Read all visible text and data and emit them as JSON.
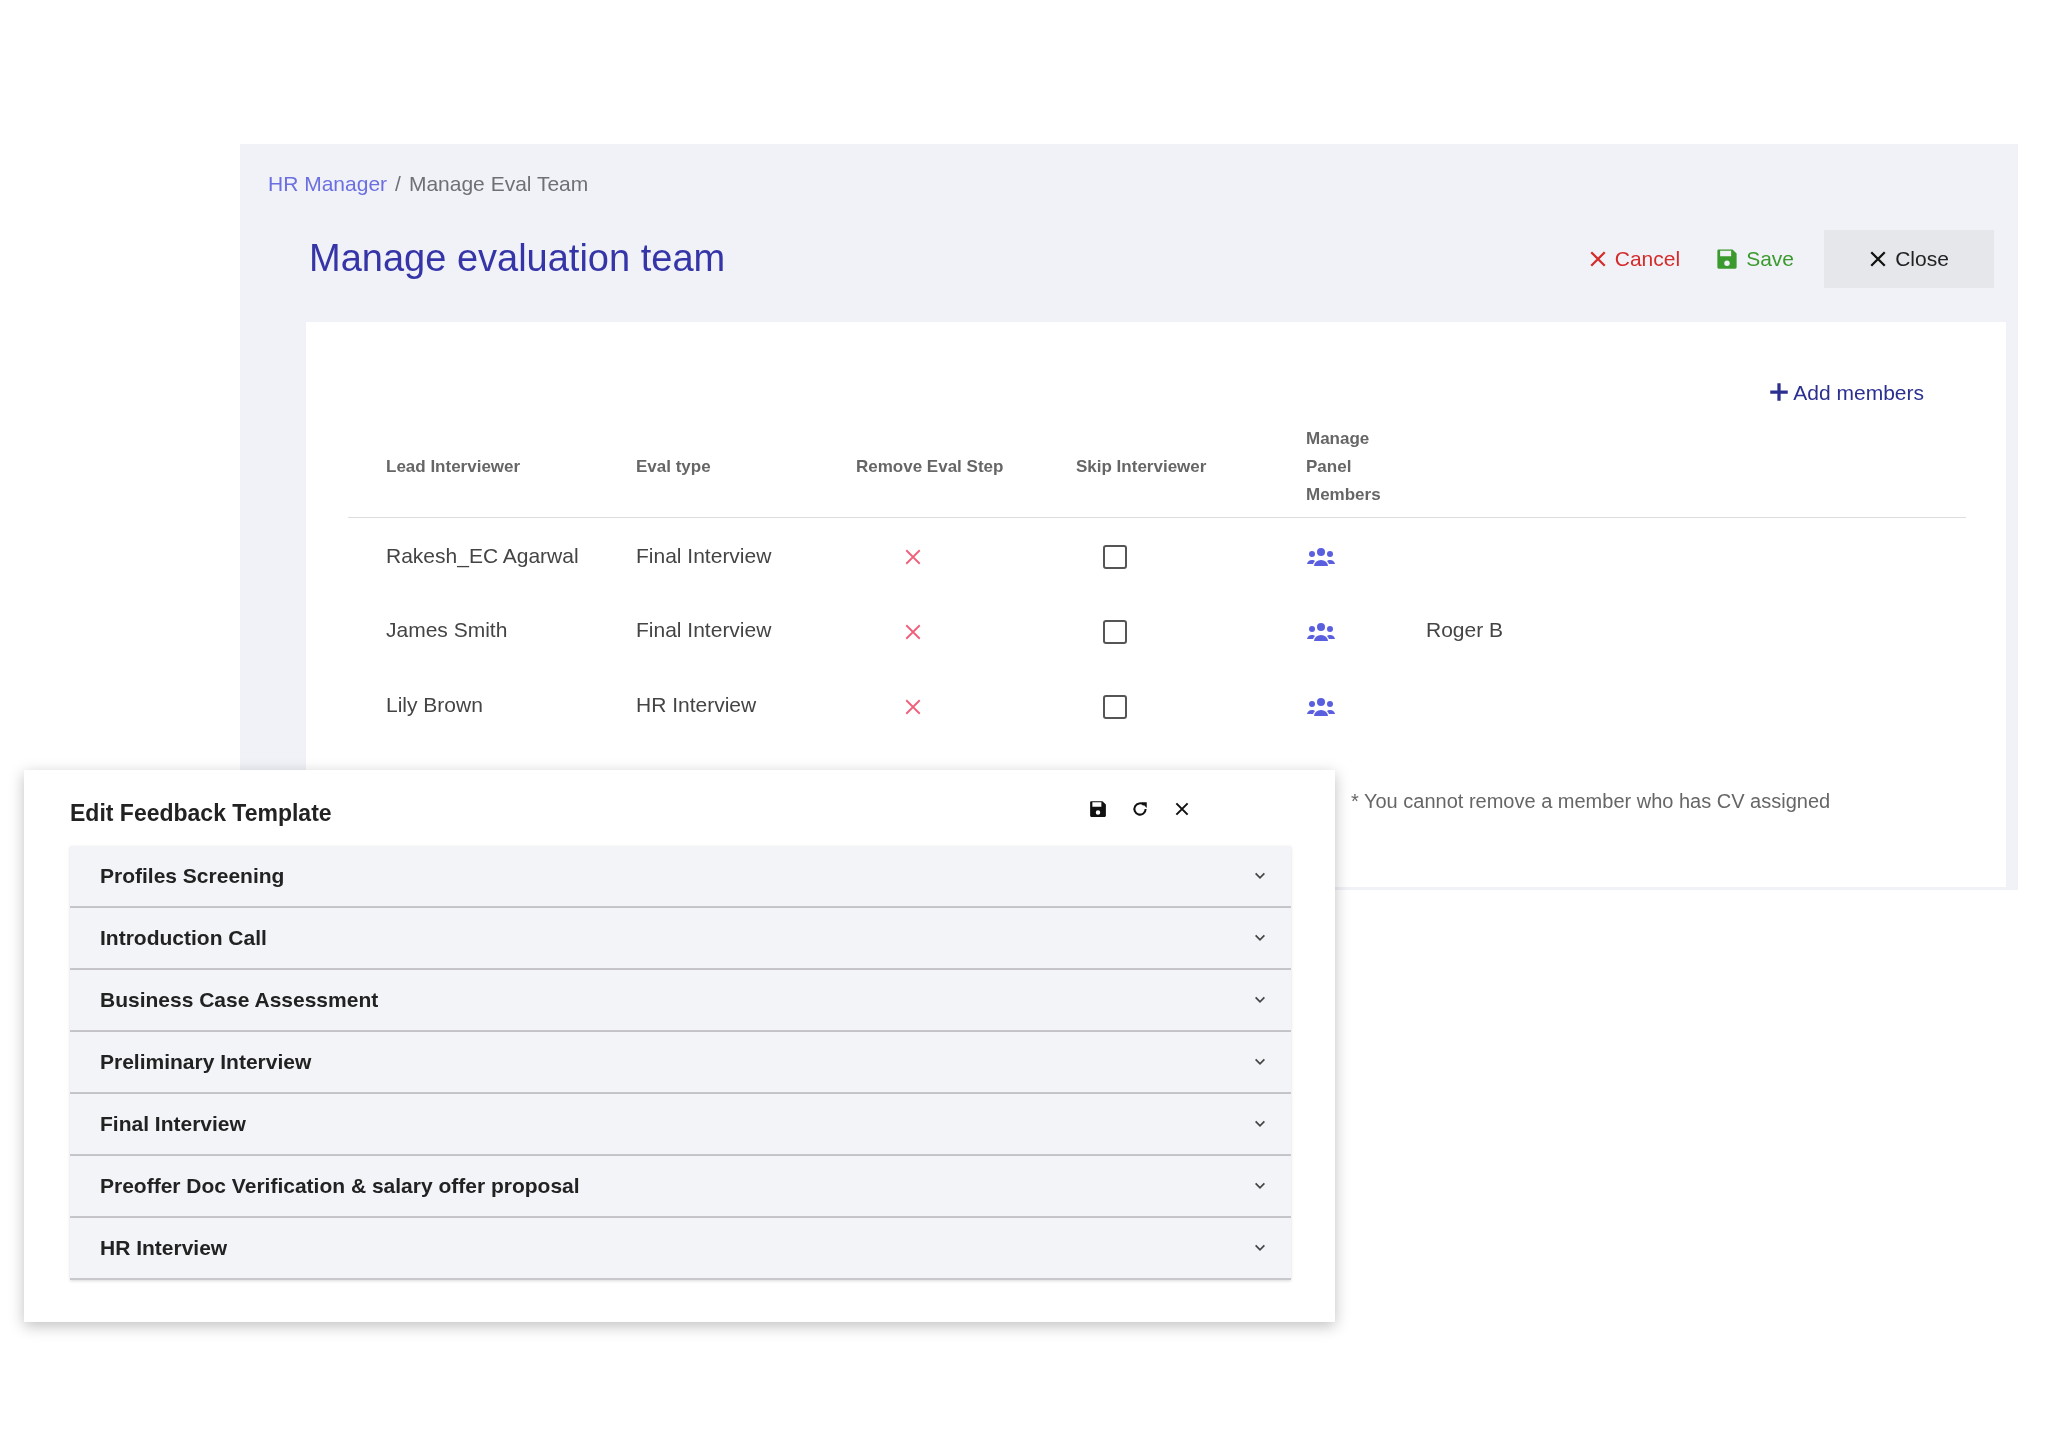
{
  "breadcrumb": [
    {
      "label": "HR Manager",
      "link": true
    },
    {
      "label": "Manage Eval Team",
      "link": false
    }
  ],
  "breadcrumb_separator": "/",
  "title": "Manage evaluation team",
  "actions": [
    {
      "kind": "cancel",
      "label": "Cancel"
    },
    {
      "kind": "save",
      "label": "Save"
    },
    {
      "kind": "close",
      "label": "Close"
    }
  ],
  "add_members": "Add members",
  "table": {
    "columns": [
      "Lead Interviewer",
      "Eval type",
      "Remove Eval Step",
      "Skip Interviewer",
      "Manage Panel Members"
    ],
    "rows": [
      {
        "lead": "Rakesh_EC Agarwal",
        "eval_type": "Final Interview",
        "skip_checked": false
      },
      {
        "lead": "James Smith",
        "eval_type": "Final Interview",
        "skip_checked": false,
        "panel": "Roger B"
      },
      {
        "lead": "Lily Brown",
        "eval_type": "HR Interview",
        "skip_checked": false
      }
    ]
  },
  "note": "* You cannot remove a member who has CV assigned",
  "dialog": {
    "title": "Edit Feedback Template",
    "sections": [
      {
        "label": "Profiles Screening",
        "expanded": false
      },
      {
        "label": "Introduction Call",
        "expanded": false
      },
      {
        "label": "Business Case Assessment",
        "expanded": false
      },
      {
        "label": "Preliminary Interview",
        "expanded": false
      },
      {
        "label": "Final Interview",
        "expanded": false
      },
      {
        "label": "Preoffer Doc Verification & salary offer proposal",
        "expanded": false
      },
      {
        "label": "HR Interview",
        "expanded": false
      }
    ]
  }
}
